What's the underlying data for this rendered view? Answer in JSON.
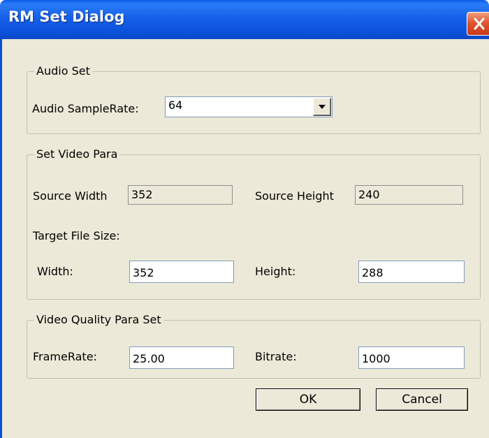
{
  "window": {
    "title": "RM Set Dialog"
  },
  "audio_group": {
    "legend": "Audio Set",
    "sample_rate_label": "Audio SampleRate:",
    "sample_rate_value": "64"
  },
  "video_group": {
    "legend": "Set Video Para",
    "source_width_label": "Source Width",
    "source_width_value": "352",
    "source_height_label": "Source Height",
    "source_height_value": "240",
    "target_label": "Target File Size:",
    "width_label": "Width:",
    "width_value": "352",
    "height_label": "Height:",
    "height_value": "288"
  },
  "quality_group": {
    "legend": "Video Quality Para Set",
    "framerate_label": "FrameRate:",
    "framerate_value": "25.00",
    "bitrate_label": "Bitrate:",
    "bitrate_value": "1000"
  },
  "buttons": {
    "ok": "OK",
    "cancel": "Cancel"
  },
  "colors": {
    "titlebar": "#1660ea",
    "dialog_face": "#ece9d8",
    "close_button": "#e0572f"
  }
}
